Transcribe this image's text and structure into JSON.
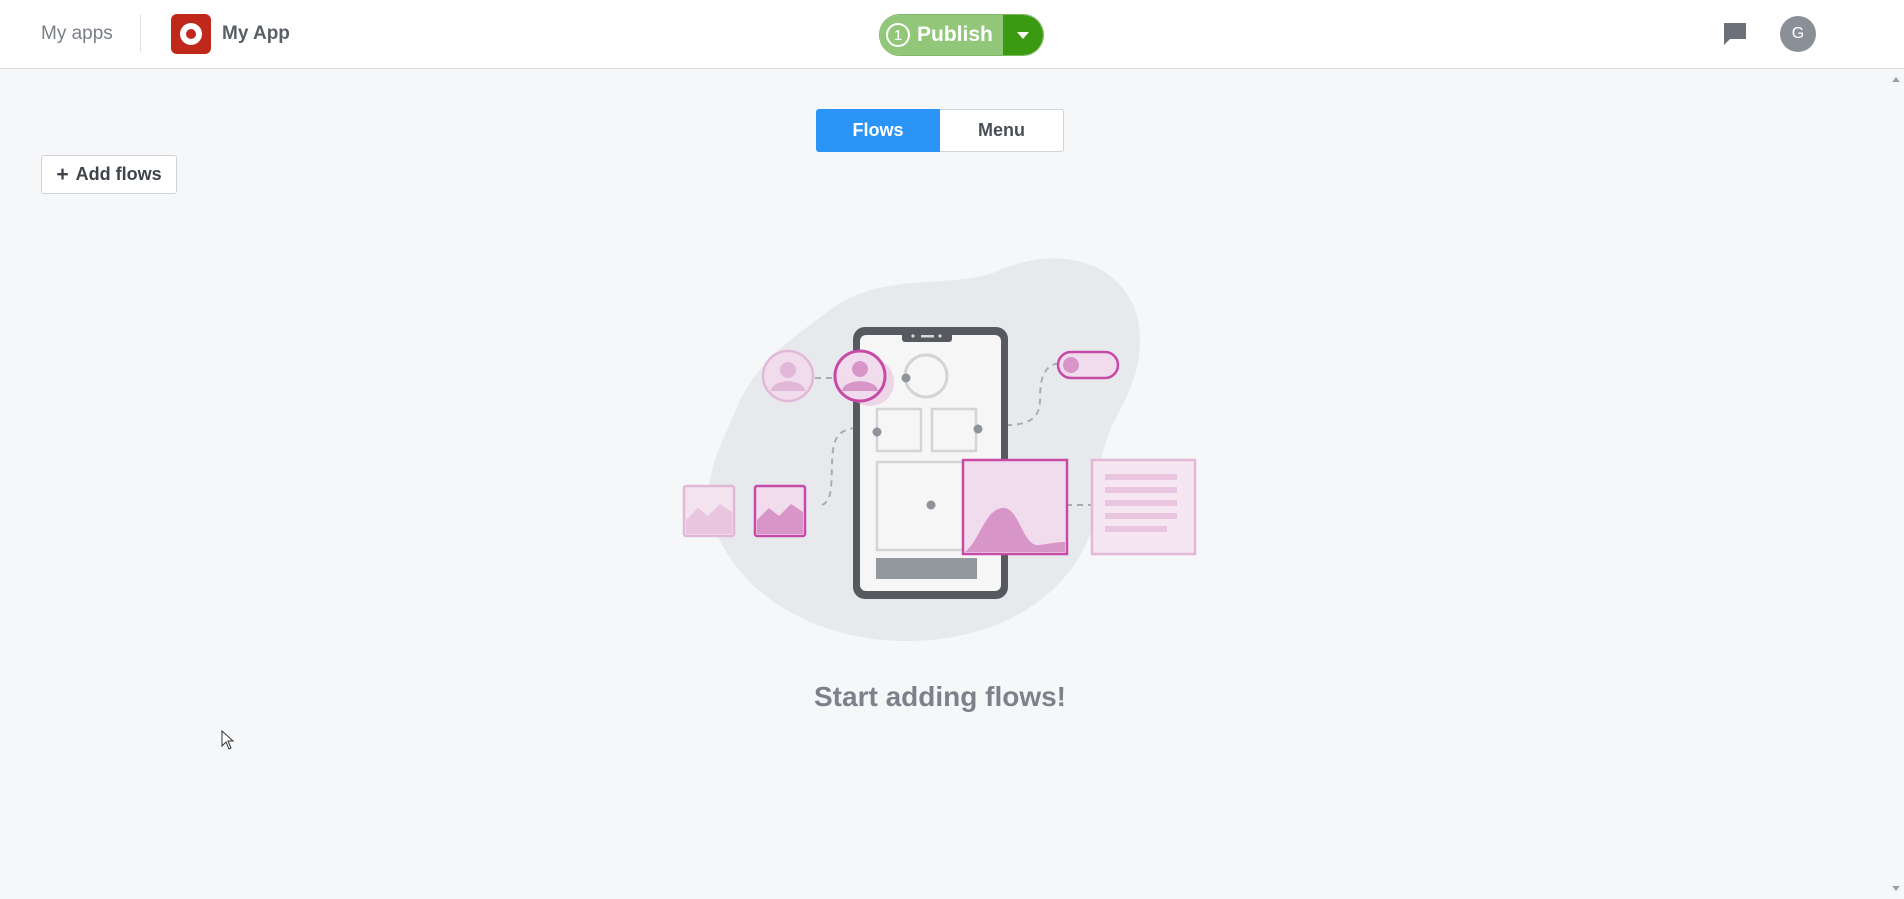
{
  "header": {
    "my_apps_label": "My apps",
    "app_name": "My App",
    "publish": {
      "count": "1",
      "label": "Publish"
    },
    "avatar_initial": "G"
  },
  "view_switcher": {
    "tabs": [
      {
        "label": "Flows",
        "active": true
      },
      {
        "label": "Menu",
        "active": false
      }
    ]
  },
  "toolbar": {
    "add_flows_label": "Add flows"
  },
  "empty_state": {
    "title": "Start adding flows!"
  },
  "colors": {
    "accent_blue": "#2b95f7",
    "publish_green_light": "#92c77a",
    "publish_green_dark": "#3a9a10",
    "app_logo_red": "#c0281c",
    "illustration_magenta": "#c64aa6"
  },
  "icons": {
    "app_logo": "app-logo-icon",
    "publish_dropdown": "caret-down-icon",
    "chat": "chat-icon",
    "add": "plus-icon"
  }
}
